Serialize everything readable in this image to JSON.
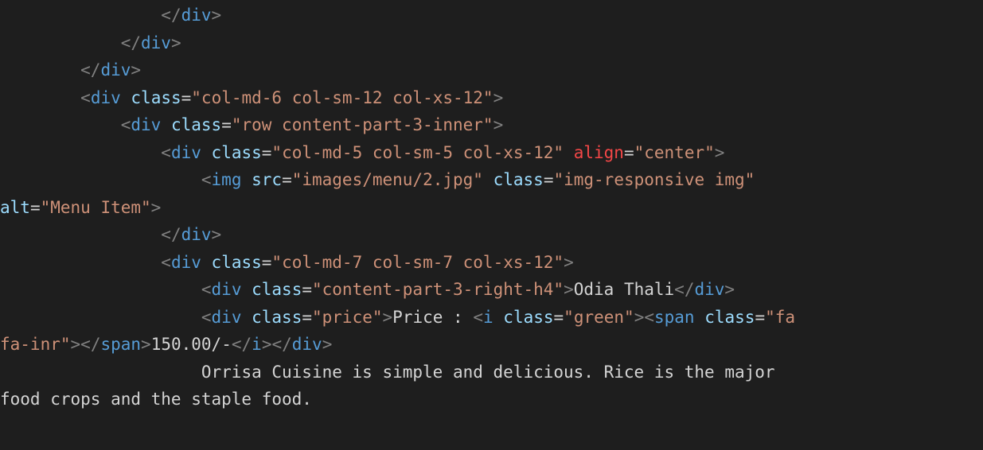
{
  "code": {
    "lines": [
      {
        "indent": "                ",
        "segments": [
          [
            "b",
            "</"
          ],
          [
            "t",
            "div"
          ],
          [
            "b",
            ">"
          ]
        ]
      },
      {
        "indent": "            ",
        "segments": [
          [
            "b",
            "</"
          ],
          [
            "t",
            "div"
          ],
          [
            "b",
            ">"
          ]
        ]
      },
      {
        "indent": "        ",
        "segments": [
          [
            "b",
            "</"
          ],
          [
            "t",
            "div"
          ],
          [
            "b",
            ">"
          ]
        ]
      },
      {
        "indent": "        ",
        "segments": [
          [
            "b",
            "<"
          ],
          [
            "t",
            "div"
          ],
          [
            "p",
            " "
          ],
          [
            "a",
            "class"
          ],
          [
            "p",
            "="
          ],
          [
            "s",
            "\"col-md-6 col-sm-12 col-xs-12\""
          ],
          [
            "b",
            ">"
          ]
        ]
      },
      {
        "indent": "            ",
        "segments": [
          [
            "b",
            "<"
          ],
          [
            "t",
            "div"
          ],
          [
            "p",
            " "
          ],
          [
            "a",
            "class"
          ],
          [
            "p",
            "="
          ],
          [
            "s",
            "\"row content-part-3-inner\""
          ],
          [
            "b",
            ">"
          ]
        ]
      },
      {
        "indent": "                ",
        "segments": [
          [
            "b",
            "<"
          ],
          [
            "t",
            "div"
          ],
          [
            "p",
            " "
          ],
          [
            "a",
            "class"
          ],
          [
            "p",
            "="
          ],
          [
            "s",
            "\"col-md-5 col-sm-5 col-xs-12\""
          ],
          [
            "p",
            " "
          ],
          [
            "r",
            "align"
          ],
          [
            "p",
            "="
          ],
          [
            "s",
            "\"center\""
          ],
          [
            "b",
            ">"
          ]
        ]
      },
      {
        "indent": "                    ",
        "segments": [
          [
            "b",
            "<"
          ],
          [
            "t",
            "img"
          ],
          [
            "p",
            " "
          ],
          [
            "a",
            "src"
          ],
          [
            "p",
            "="
          ],
          [
            "s",
            "\"images/menu/2.jpg\""
          ],
          [
            "p",
            " "
          ],
          [
            "a",
            "class"
          ],
          [
            "p",
            "="
          ],
          [
            "s",
            "\"img-responsive img\""
          ]
        ]
      },
      {
        "indent": "",
        "segments": [
          [
            "a",
            "alt"
          ],
          [
            "p",
            "="
          ],
          [
            "s",
            "\"Menu Item\""
          ],
          [
            "b",
            ">"
          ]
        ]
      },
      {
        "indent": "                ",
        "segments": [
          [
            "b",
            "</"
          ],
          [
            "t",
            "div"
          ],
          [
            "b",
            ">"
          ]
        ]
      },
      {
        "indent": "                ",
        "segments": [
          [
            "b",
            "<"
          ],
          [
            "t",
            "div"
          ],
          [
            "p",
            " "
          ],
          [
            "a",
            "class"
          ],
          [
            "p",
            "="
          ],
          [
            "s",
            "\"col-md-7 col-sm-7 col-xs-12\""
          ],
          [
            "b",
            ">"
          ]
        ]
      },
      {
        "indent": "                    ",
        "segments": [
          [
            "b",
            "<"
          ],
          [
            "t",
            "div"
          ],
          [
            "p",
            " "
          ],
          [
            "a",
            "class"
          ],
          [
            "p",
            "="
          ],
          [
            "s",
            "\"content-part-3-right-h4\""
          ],
          [
            "b",
            ">"
          ],
          [
            "p",
            "Odia Thali"
          ],
          [
            "b",
            "</"
          ],
          [
            "t",
            "div"
          ],
          [
            "b",
            ">"
          ]
        ]
      },
      {
        "indent": "                    ",
        "segments": [
          [
            "b",
            "<"
          ],
          [
            "t",
            "div"
          ],
          [
            "p",
            " "
          ],
          [
            "a",
            "class"
          ],
          [
            "p",
            "="
          ],
          [
            "s",
            "\"price\""
          ],
          [
            "b",
            ">"
          ],
          [
            "p",
            "Price : "
          ],
          [
            "b",
            "<"
          ],
          [
            "t",
            "i"
          ],
          [
            "p",
            " "
          ],
          [
            "a",
            "class"
          ],
          [
            "p",
            "="
          ],
          [
            "s",
            "\"green\""
          ],
          [
            "b",
            ">"
          ],
          [
            "b",
            "<"
          ],
          [
            "t",
            "span"
          ],
          [
            "p",
            " "
          ],
          [
            "a",
            "class"
          ],
          [
            "p",
            "="
          ],
          [
            "s",
            "\"fa"
          ]
        ]
      },
      {
        "indent": "",
        "segments": [
          [
            "s",
            "fa-inr\""
          ],
          [
            "b",
            ">"
          ],
          [
            "b",
            "</"
          ],
          [
            "t",
            "span"
          ],
          [
            "b",
            ">"
          ],
          [
            "p",
            "150.00/-"
          ],
          [
            "b",
            "</"
          ],
          [
            "t",
            "i"
          ],
          [
            "b",
            ">"
          ],
          [
            "b",
            "</"
          ],
          [
            "t",
            "div"
          ],
          [
            "b",
            ">"
          ]
        ]
      },
      {
        "indent": "                    ",
        "segments": [
          [
            "p",
            "Orrisa Cuisine is simple and delicious. Rice is the major"
          ]
        ]
      },
      {
        "indent": "",
        "segments": [
          [
            "p",
            "food crops and the staple food."
          ]
        ]
      }
    ]
  }
}
